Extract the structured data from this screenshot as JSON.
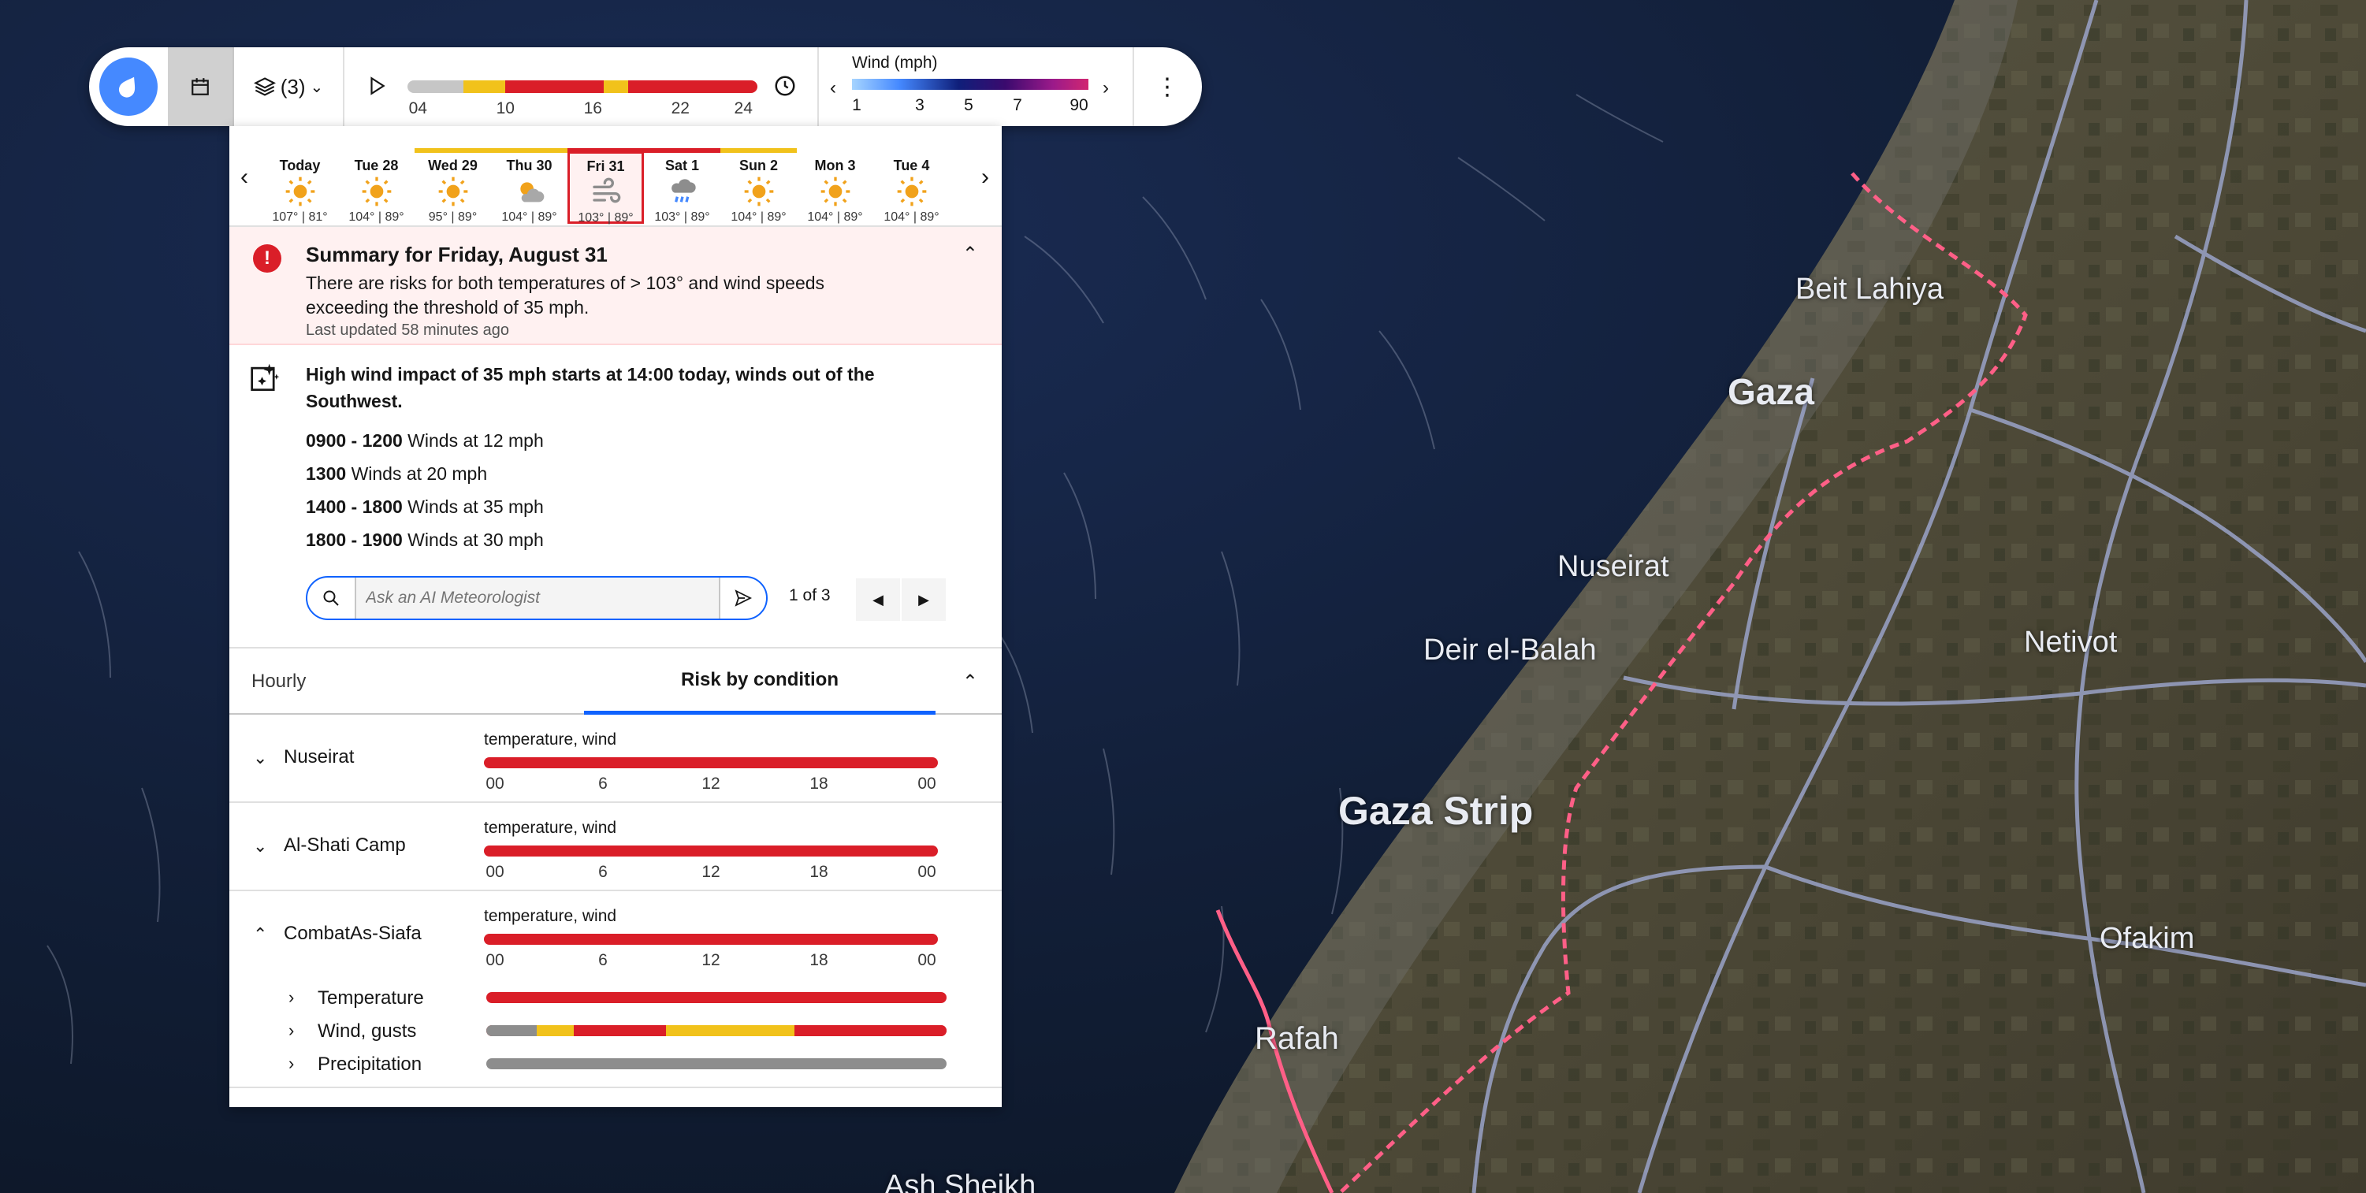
{
  "toolbar": {
    "layers_label": "(3)",
    "timeline_ticks": [
      "04",
      "10",
      "16",
      "22",
      "24"
    ],
    "legend_title": "Wind (mph)",
    "legend_values": [
      "1",
      "3",
      "5",
      "7",
      "90"
    ],
    "colors": {
      "accent": "#4589ff",
      "risk_high": "#da1e28",
      "risk_medium": "#f1c21b",
      "risk_none": "#c6c6c6"
    }
  },
  "days": [
    {
      "label": "Today",
      "icon": "sun-icon",
      "temps": "107° | 81°",
      "status": "none"
    },
    {
      "label": "Tue 28",
      "icon": "sun-icon",
      "temps": "104° | 89°",
      "status": "none"
    },
    {
      "label": "Wed 29",
      "icon": "sun-icon",
      "temps": "95° | 89°",
      "status": "warn"
    },
    {
      "label": "Thu 30",
      "icon": "partly-cloudy-icon",
      "temps": "104° | 89°",
      "status": "warn"
    },
    {
      "label": "Fri 31",
      "icon": "wind-icon",
      "temps": "103° | 89°",
      "status": "selected"
    },
    {
      "label": "Sat 1",
      "icon": "rain-icon",
      "temps": "103° | 89°",
      "status": "alert"
    },
    {
      "label": "Sun 2",
      "icon": "sun-icon",
      "temps": "104° | 89°",
      "status": "warn"
    },
    {
      "label": "Mon 3",
      "icon": "sun-icon",
      "temps": "104° | 89°",
      "status": "none"
    },
    {
      "label": "Tue 4",
      "icon": "sun-icon",
      "temps": "104° | 89°",
      "status": "none"
    }
  ],
  "summary": {
    "title": "Summary for Friday, August 31",
    "body": "There are risks for both temperatures of > 103° and wind speeds exceeding the threshold of 35 mph.",
    "updated": "Last updated 58 minutes ago"
  },
  "ai": {
    "headline": "High wind impact of 35 mph starts at 14:00 today, winds out of the Southwest.",
    "rows": [
      {
        "time": "0900 - 1200",
        "text": "Winds at 12 mph"
      },
      {
        "time": "1300",
        "text": "Winds at 20 mph"
      },
      {
        "time": "1400 - 1800",
        "text": "Winds at 35 mph"
      },
      {
        "time": "1800 - 1900",
        "text": "Winds at 30 mph"
      }
    ],
    "ask_placeholder": "Ask an AI Meteorologist",
    "pagination": "1 of 3"
  },
  "tabs": {
    "hourly": "Hourly",
    "risk": "Risk by condition"
  },
  "risk_ticks": [
    "00",
    "6",
    "12",
    "18",
    "00"
  ],
  "locations": [
    {
      "name": "Nuseirat",
      "conditions": "temperature, wind"
    },
    {
      "name": "Al-Shati Camp",
      "conditions": "temperature, wind"
    },
    {
      "name": "CombatAs-Siafa",
      "conditions": "temperature, wind"
    }
  ],
  "sub_conditions": [
    {
      "name": "Temperature"
    },
    {
      "name": "Wind, gusts"
    },
    {
      "name": "Precipitation"
    }
  ],
  "map_labels": {
    "beit_lahiya": "Beit Lahiya",
    "gaza": "Gaza",
    "nuseirat": "Nuseirat",
    "deir_el_balah": "Deir el-Balah",
    "netivot": "Netivot",
    "gaza_strip": "Gaza Strip",
    "ofakim": "Ofakim",
    "rafah": "Rafah",
    "ash_sheikh": "Ash Sheikh"
  }
}
